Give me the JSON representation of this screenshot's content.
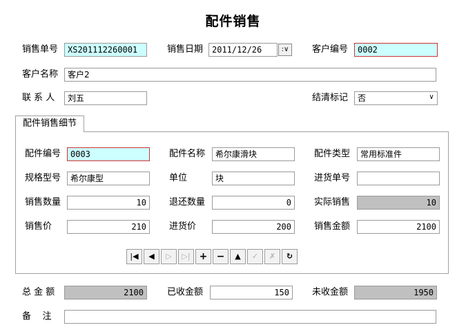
{
  "title": "配件销售",
  "header": {
    "sale_no": {
      "label": "销售单号",
      "value": "XS201112260001"
    },
    "sale_date": {
      "label": "销售日期",
      "value": "2011/12/26"
    },
    "customer_no": {
      "label": "客户编号",
      "value": "0002"
    },
    "customer_name": {
      "label": "客户名称",
      "value": "客户2"
    },
    "contact": {
      "label": "联 系 人",
      "value": "刘五"
    },
    "settled": {
      "label": "结清标记",
      "value": "否"
    }
  },
  "detail": {
    "tab_label": "配件销售细节",
    "part_no": {
      "label": "配件编号",
      "value": "0003"
    },
    "part_name": {
      "label": "配件名称",
      "value": "希尔康滑块"
    },
    "part_type": {
      "label": "配件类型",
      "value": "常用标准件"
    },
    "spec": {
      "label": "规格型号",
      "value": "希尔康型"
    },
    "unit": {
      "label": "单位",
      "value": "块"
    },
    "purchase_no": {
      "label": "进货单号",
      "value": ""
    },
    "sale_qty": {
      "label": "销售数量",
      "value": "10"
    },
    "return_qty": {
      "label": "退还数量",
      "value": "0"
    },
    "actual_sale": {
      "label": "实际销售",
      "value": "10"
    },
    "sale_price": {
      "label": "销售价",
      "value": "210"
    },
    "purchase_price": {
      "label": "进货价",
      "value": "200"
    },
    "sale_amount": {
      "label": "销售金额",
      "value": "2100"
    }
  },
  "navigator": {
    "icons": [
      "first-icon",
      "prior-icon",
      "next-icon",
      "last-icon",
      "insert-icon",
      "delete-icon",
      "edit-icon",
      "post-icon",
      "cancel-icon",
      "refresh-icon"
    ],
    "glyphs": {
      "first": "|◀",
      "prior": "◀",
      "next": "▷",
      "last": "▷|",
      "insert": "+",
      "delete": "−",
      "edit": "▲",
      "post": "✓",
      "cancel": "✗",
      "refresh": "↻"
    }
  },
  "footer": {
    "total": {
      "label": "总 金 额",
      "value": "2100"
    },
    "received": {
      "label": "已收金额",
      "value": "150"
    },
    "unreceived": {
      "label": "未收金额",
      "value": "1950"
    },
    "remark": {
      "label": "备    注",
      "value": ""
    }
  },
  "colors": {
    "highlight_field": "#ccffff",
    "readonly_field": "#c0c0c0",
    "required_border": "#cc3333"
  }
}
